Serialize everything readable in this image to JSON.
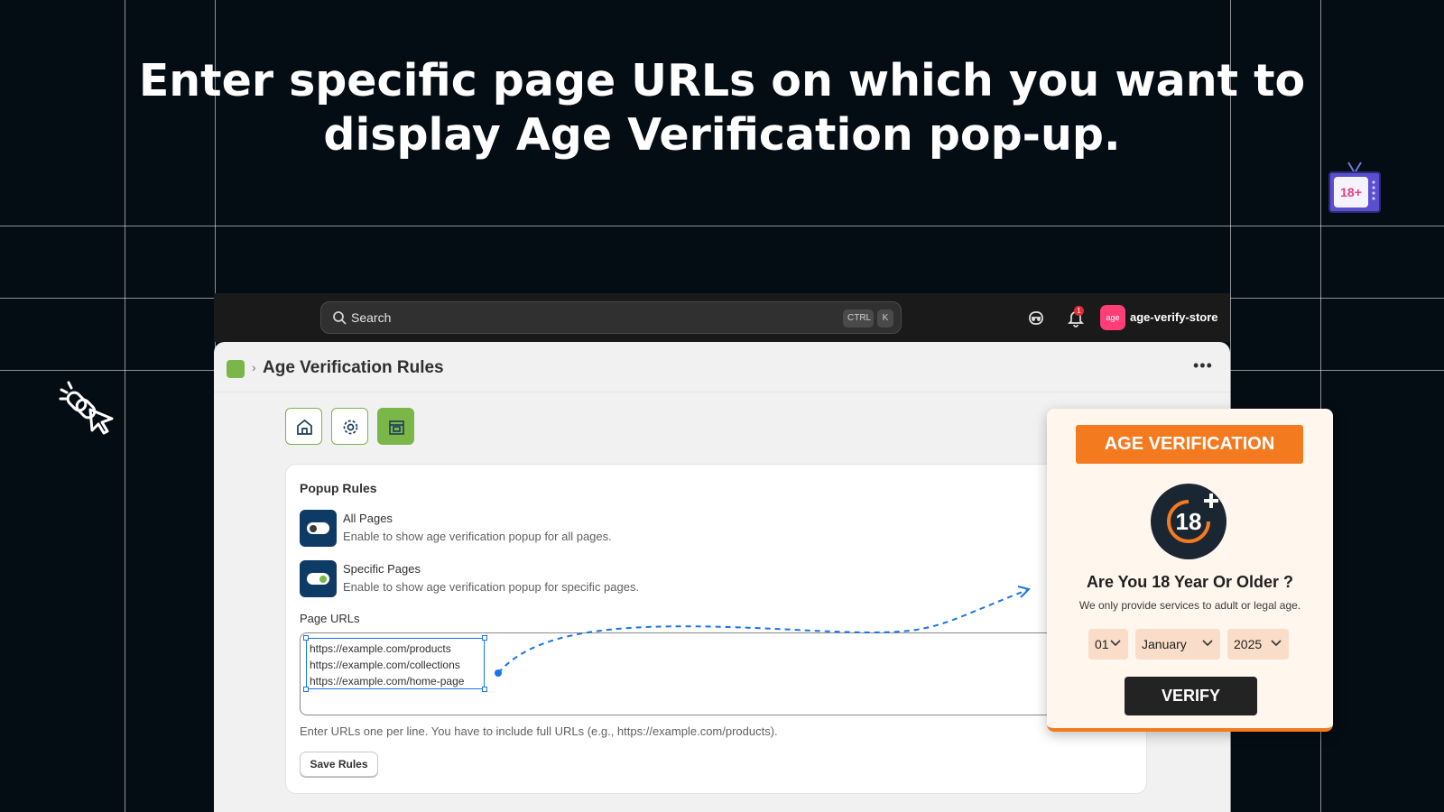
{
  "headline": {
    "line1": "Enter specific page URLs on which you want to",
    "line2": "display Age Verification pop-up."
  },
  "topbar": {
    "search_placeholder": "Search",
    "shortcut_ctrl": "CTRL",
    "shortcut_k": "K",
    "notification_count": "1",
    "store_avatar_text": "age",
    "store_name": "age-verify-store"
  },
  "page": {
    "title": "Age Verification Rules",
    "breadcrumb_separator": "›",
    "more_label": "•••"
  },
  "nav": [
    "home-icon",
    "gear-icon",
    "rules-icon"
  ],
  "card": {
    "title": "Popup Rules",
    "rules": [
      {
        "label": "All Pages",
        "description": "Enable to show age verification popup for all pages.",
        "enabled": false
      },
      {
        "label": "Specific Pages",
        "description": "Enable to show age verification popup for specific pages.",
        "enabled": true
      }
    ],
    "urls_label": "Page URLs",
    "urls": [
      "https://example.com/products",
      "https://example.com/collections",
      "https://example.com/home-page"
    ],
    "urls_hint": "Enter URLs one per line. You have to include full URLs (e.g., https://example.com/products).",
    "save_label": "Save Rules"
  },
  "popup": {
    "badge": "AGE VERIFICATION",
    "icon_text": "18",
    "question": "Are You 18 Year Or Older ?",
    "subtitle": "We only provide services to adult or legal age.",
    "day": "01",
    "month": "January",
    "year": "2025",
    "verify_label": "VERIFY"
  },
  "tv_icon_text": "18+",
  "colors": {
    "background": "#040c14",
    "accent_green": "#7ab648",
    "accent_orange": "#f47a20",
    "toggle_navy": "#0d3b66"
  }
}
